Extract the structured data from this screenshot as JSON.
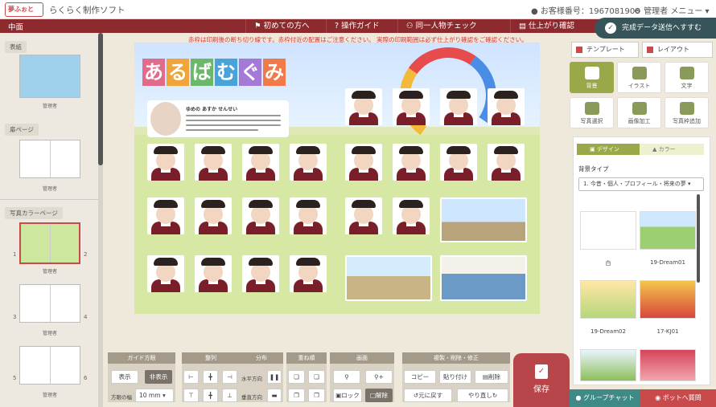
{
  "app": {
    "logo": "夢ふぉと",
    "title": "らくらく制作ソフト",
    "customer_no": "お客様番号：1967081906",
    "admin_menu": "管理者 メニュー"
  },
  "nav": {
    "section": "中面",
    "items": [
      "初めての方へ",
      "操作ガイド",
      "同一人物チェック",
      "仕上がり確認"
    ],
    "send_button": "完成データ送信へすすむ"
  },
  "notice": "赤枠は印刷後の断ち切り線です。赤枠付近の配置はご注意ください。 実際の印刷範囲は必ず仕上がり確認をご確認ください。",
  "sidebar": {
    "sections": [
      {
        "label": "表紙",
        "caption": "管理者"
      },
      {
        "label": "扉ページ",
        "caption": "管理者"
      },
      {
        "label": "写真カラーページ",
        "pages": [
          {
            "left": "1",
            "right": "2",
            "caption": "管理者"
          },
          {
            "left": "3",
            "right": "4",
            "caption": "管理者"
          },
          {
            "left": "5",
            "right": "6",
            "caption": "管理者"
          }
        ]
      }
    ]
  },
  "canvas": {
    "title_chars": [
      "あ",
      "る",
      "ば",
      "む",
      "ぐ",
      "み"
    ],
    "title_colors": [
      "#e26a8a",
      "#f0a53a",
      "#6cb86a",
      "#4aa3d8",
      "#a57ad6",
      "#f07a4a"
    ],
    "teacher_name": "ゆめの あすか せんせい"
  },
  "toolbar": {
    "groups": [
      "ガイド方眼",
      "整列",
      "分布",
      "重ね順",
      "画面",
      "複製・削除・修正"
    ],
    "show": "表示",
    "hide": "非表示",
    "grid_width_label": "方眼の幅",
    "grid_width_value": "10 mm",
    "horizontal": "水平方向",
    "vertical": "垂直方向",
    "lock": "ロック",
    "unlock": "解除",
    "copy": "コピー",
    "paste": "貼り付け",
    "delete": "削除",
    "undo": "元に戻す",
    "redo": "やり直し",
    "save": "保存"
  },
  "right_panel": {
    "tabs": [
      "テンプレート",
      "レイアウト"
    ],
    "tiles": [
      "背景",
      "イラスト",
      "文字",
      "写真選択",
      "画像加工",
      "写真枠追加"
    ],
    "design_tabs": [
      "デザイン",
      "カラー"
    ],
    "bg_type_label": "背景タイプ",
    "bg_type_value": "1. 今昔・個人・プロフィール・将来の夢",
    "thumbs": [
      "白",
      "19-Dream01",
      "19-Dream02",
      "17-KJ01"
    ],
    "chat": "グループチャット",
    "bot": "ボットへ質問"
  }
}
